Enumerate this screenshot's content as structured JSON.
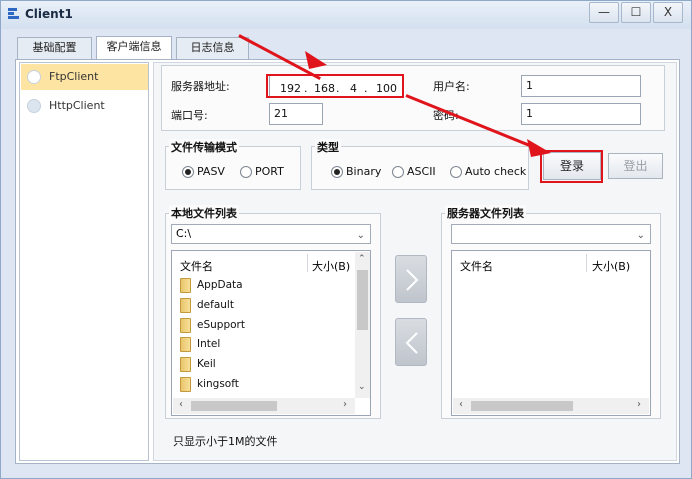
{
  "window": {
    "title": "Client1",
    "min_glyph": "—",
    "max_glyph": "☐",
    "close_glyph": "X"
  },
  "tabs": [
    {
      "label": "基础配置",
      "active": false
    },
    {
      "label": "客户端信息",
      "active": true
    },
    {
      "label": "日志信息",
      "active": false
    }
  ],
  "sidebar": {
    "items": [
      {
        "label": "FtpClient",
        "selected": true
      },
      {
        "label": "HttpClient",
        "selected": false
      }
    ]
  },
  "server": {
    "address_label": "服务器地址:",
    "ip": [
      "192",
      "168",
      "4",
      "100"
    ],
    "ip_sep": ".",
    "username_label": "用户名:",
    "username_value": "1",
    "port_label": "端口号:",
    "port_value": "21",
    "password_label": "密码:",
    "password_value": "1"
  },
  "transfer_mode": {
    "title": "文件传输模式",
    "options": [
      "PASV",
      "PORT"
    ],
    "selected": "PASV"
  },
  "type_group": {
    "title": "类型",
    "options": [
      "Binary",
      "ASCII",
      "Auto check"
    ],
    "selected": "Binary"
  },
  "buttons": {
    "login": "登录",
    "logout": "登出"
  },
  "local": {
    "title": "本地文件列表",
    "path": "C:\\",
    "col_name": "文件名",
    "col_size": "大小(B)",
    "files": [
      "AppData",
      "default",
      "eSupport",
      "Intel",
      "Keil",
      "kingsoft"
    ]
  },
  "remote": {
    "title": "服务器文件列表",
    "path": "",
    "col_name": "文件名",
    "col_size": "大小(B)"
  },
  "filter_note": "只显示小于1M的文件",
  "icons": {
    "upload": "chevron-right-icon",
    "download": "chevron-left-icon"
  },
  "colors": {
    "highlight_red": "#e0141b",
    "selected_nav": "#fde4a3"
  }
}
